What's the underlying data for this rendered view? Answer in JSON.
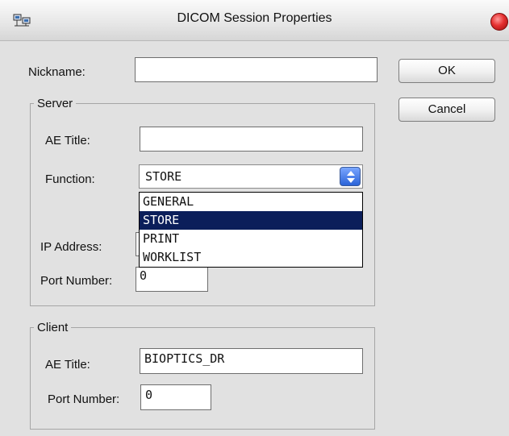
{
  "window": {
    "title": "DICOM Session Properties",
    "icons": {
      "app": "network-computer-icon",
      "close": "close-icon"
    },
    "colors": {
      "dialog_bg": "#e1e1e1",
      "selection": "#0b1e5a",
      "close": "#e53030"
    }
  },
  "nickname": {
    "label": "Nickname:",
    "value": ""
  },
  "buttons": {
    "ok": "OK",
    "cancel": "Cancel"
  },
  "server": {
    "legend": "Server",
    "ae_title": {
      "label": "AE Title:",
      "value": ""
    },
    "function": {
      "label": "Function:",
      "selected": "STORE",
      "options": [
        "GENERAL",
        "STORE",
        "PRINT",
        "WORKLIST"
      ],
      "highlighted_option": "STORE"
    },
    "ip_address": {
      "label": "IP Address:",
      "value": ""
    },
    "port_number": {
      "label": "Port Number:",
      "value": "0"
    }
  },
  "client": {
    "legend": "Client",
    "ae_title": {
      "label": "AE Title:",
      "value": "BIOPTICS_DR"
    },
    "port_number": {
      "label": "Port Number:",
      "value": "0"
    }
  }
}
